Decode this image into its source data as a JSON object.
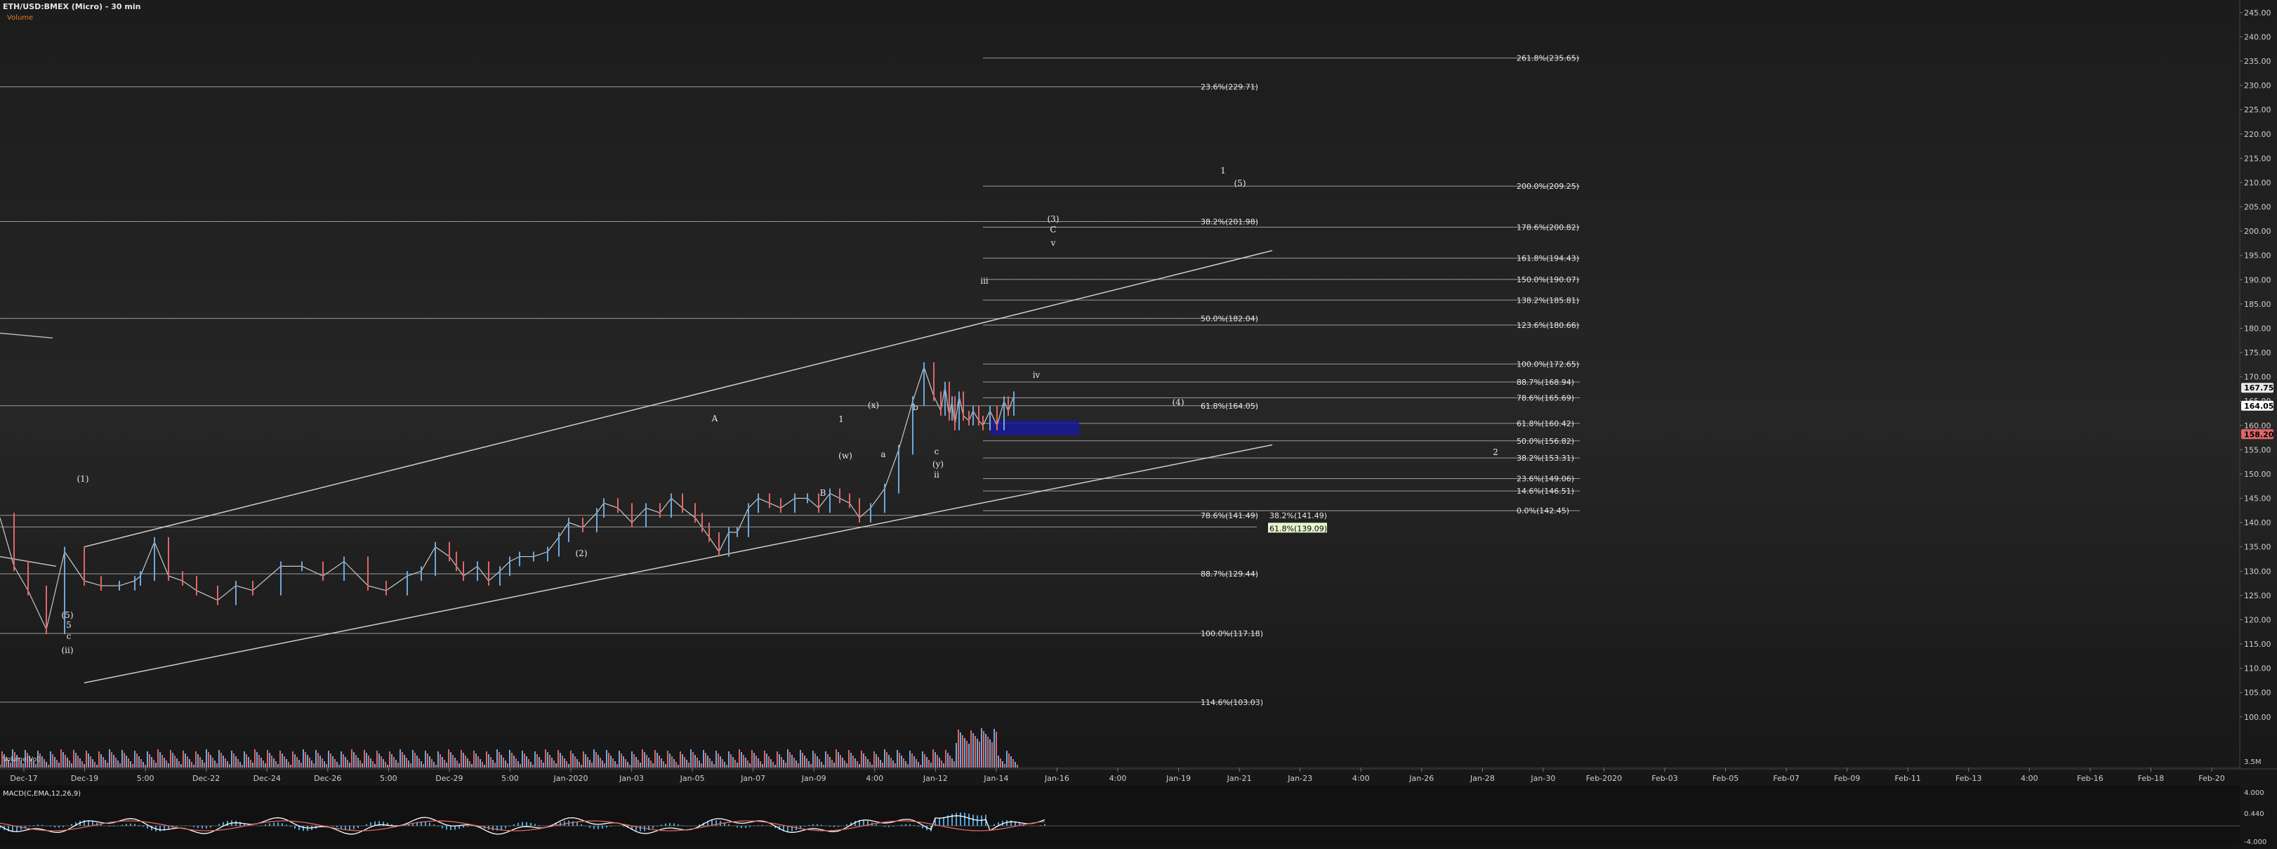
{
  "header": {
    "title": "ETH/USD:BMEX (Micro) - 30 min",
    "subtitle": "Volume"
  },
  "colors": {
    "background": "#0d0d0d",
    "up_candle": "#6fa8dc",
    "down_candle": "#e06666",
    "fib_line": "#9a9a9a",
    "box": "#1a1a9a",
    "macd_line": "#ffffff",
    "signal_line": "#e06666"
  },
  "volume_label": "Volume(Vol)",
  "macd_label": "MACD(C,EMA,12,26,9)",
  "chart_data": {
    "type": "line",
    "title": "ETH/USD:BMEX (Micro) - 30 min",
    "x_ticks": [
      "Dec-17",
      "Dec-19",
      "5:00",
      "Dec-22",
      "Dec-24",
      "Dec-26",
      "5:00",
      "Dec-29",
      "5:00",
      "Jan-2020",
      "Jan-03",
      "Jan-05",
      "Jan-07",
      "Jan-09",
      "4:00",
      "Jan-12",
      "Jan-14",
      "Jan-16",
      "4:00",
      "Jan-19",
      "Jan-21",
      "Jan-23",
      "4:00",
      "Jan-26",
      "Jan-28",
      "Jan-30",
      "Feb-2020",
      "Feb-03",
      "Feb-05",
      "Feb-07",
      "Feb-09",
      "Feb-11",
      "Feb-13",
      "4:00",
      "Feb-16",
      "Feb-18",
      "Feb-20"
    ],
    "y_ticks": [
      "245.00",
      "240.00",
      "235.00",
      "230.00",
      "225.00",
      "220.00",
      "215.00",
      "210.00",
      "205.00",
      "200.00",
      "195.00",
      "190.00",
      "185.00",
      "180.00",
      "175.00",
      "170.00",
      "165.00",
      "160.00",
      "155.00",
      "150.00",
      "145.00",
      "140.00",
      "135.00",
      "130.00",
      "125.00",
      "120.00",
      "115.00",
      "110.00",
      "105.00",
      "100.00"
    ],
    "ylim": [
      96.5,
      246
    ],
    "price_labels": [
      "167.75",
      "164.05",
      "158.20"
    ],
    "volume_axis_label": "3.5M",
    "macd_ticks": [
      "4.000",
      "0.440",
      "-4.000"
    ],
    "series": [
      {
        "x": [
          0,
          10,
          20,
          33,
          46,
          60,
          72,
          85,
          96,
          100,
          110,
          120,
          130,
          140,
          155,
          168,
          180,
          200,
          215,
          230,
          245,
          262,
          275,
          290,
          300,
          310,
          320,
          325,
          330,
          340,
          348,
          356,
          363,
          370,
          380,
          390,
          398,
          405,
          415,
          425,
          430,
          440,
          450,
          460,
          470,
          478,
          486,
          495,
          500,
          505,
          512,
          519,
          525,
          533,
          540,
          548,
          556,
          566,
          575,
          583,
          591,
          598,
          605,
          612,
          620,
          630,
          640,
          650,
          658,
          665,
          670,
          673,
          676,
          678,
          680,
          683,
          686,
          690,
          693,
          697,
          700,
          705,
          710,
          715,
          718,
          722
        ],
        "values": [
          141,
          131,
          126,
          118,
          134,
          128,
          127,
          127,
          128,
          129,
          136,
          129,
          128,
          126,
          124,
          127,
          126,
          131,
          131,
          129,
          132,
          127,
          126,
          129,
          130,
          135,
          133,
          131,
          129,
          131,
          128,
          130,
          132,
          133,
          133,
          134,
          137,
          140,
          139,
          142,
          144,
          143,
          140,
          143,
          142,
          145,
          143,
          141,
          139,
          137,
          134,
          138,
          138,
          143,
          145,
          144,
          143,
          145,
          145,
          143,
          146,
          145,
          144,
          141,
          143,
          147,
          155,
          165,
          172,
          166,
          163,
          168,
          162,
          165,
          160,
          166,
          162,
          161,
          163,
          161,
          160,
          163,
          160,
          165,
          163,
          166
        ]
      }
    ],
    "annotations": {
      "fib_left": [
        "23.6%(229.71)",
        "38.2%(201.98)",
        "50.0%(182.04)",
        "61.8%(164.05)",
        "78.6%(141.49)",
        "38.2%(141.49)",
        "61.8%(139.09)",
        "88.7%(129.44)",
        "100.0%(117.18)",
        "114.6%(103.03)"
      ],
      "fib_right": [
        "261.8%(235.65)",
        "200.0%(209.25)",
        "178.6%(200.82)",
        "161.8%(194.43)",
        "150.0%(190.07)",
        "138.2%(185.81)",
        "123.6%(180.66)",
        "100.0%(172.65)",
        "88.7%(168.94)",
        "78.6%(165.69)",
        "61.8%(160.42)",
        "50.0%(156.82)",
        "38.2%(153.31)",
        "23.6%(149.06)",
        "14.6%(146.51)",
        "0.0%(142.45)"
      ],
      "wave_labels": [
        "(1)",
        "(5)",
        "5",
        "c",
        "(ii)",
        "(2)",
        "A",
        "B",
        "1",
        "(w)",
        "(x)",
        "a",
        "b",
        "c",
        "(y)",
        "ii",
        "iii",
        "(3)",
        "C",
        "v",
        "(4)",
        "1",
        "(5)",
        "iv",
        "2"
      ]
    }
  }
}
